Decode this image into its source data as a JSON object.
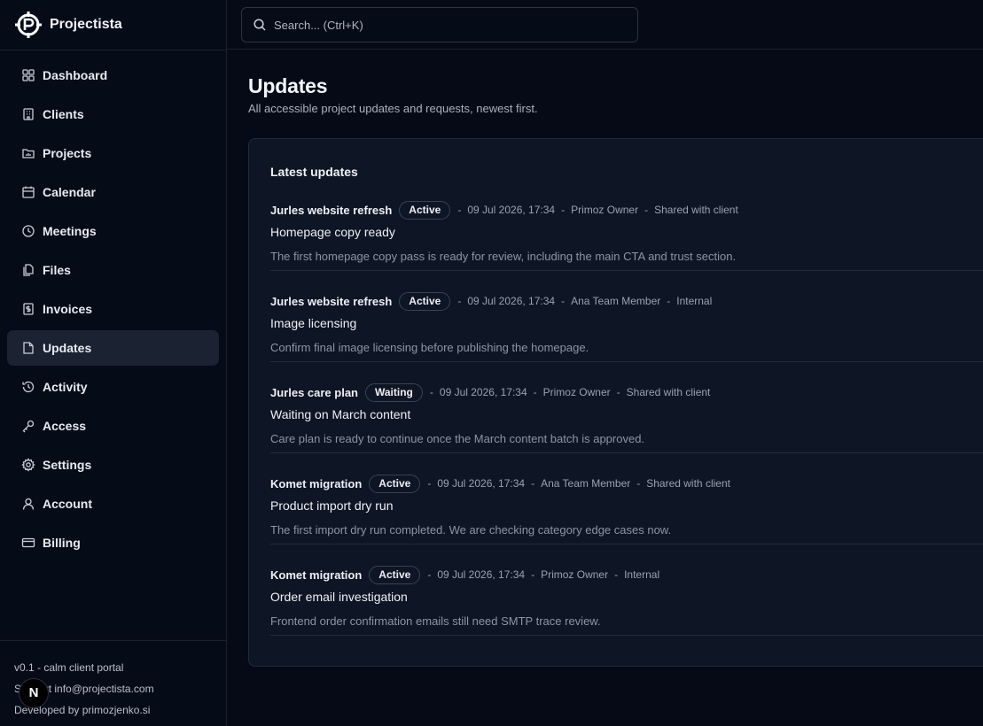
{
  "app": {
    "name": "Projectista"
  },
  "search": {
    "placeholder": "Search... (Ctrl+K)"
  },
  "sidebar": {
    "items": [
      {
        "label": "Dashboard",
        "icon": "grid-icon"
      },
      {
        "label": "Clients",
        "icon": "building-icon"
      },
      {
        "label": "Projects",
        "icon": "folder-icon"
      },
      {
        "label": "Calendar",
        "icon": "calendar-icon"
      },
      {
        "label": "Meetings",
        "icon": "clock-icon"
      },
      {
        "label": "Files",
        "icon": "files-icon"
      },
      {
        "label": "Invoices",
        "icon": "invoice-icon"
      },
      {
        "label": "Updates",
        "icon": "file-icon",
        "active": true
      },
      {
        "label": "Activity",
        "icon": "history-icon"
      },
      {
        "label": "Access",
        "icon": "key-icon"
      },
      {
        "label": "Settings",
        "icon": "gear-icon"
      },
      {
        "label": "Account",
        "icon": "user-icon"
      },
      {
        "label": "Billing",
        "icon": "credit-card-icon"
      }
    ],
    "footer": {
      "version": "v0.1 - calm client portal",
      "support": "Support info@projectista.com",
      "developed": "Developed by primozjenko.si",
      "badge": "N"
    }
  },
  "page": {
    "title": "Updates",
    "subtitle": "All accessible project updates and requests, newest first."
  },
  "card": {
    "title": "Latest updates",
    "updates": [
      {
        "project": "Jurles website refresh",
        "status": "Active",
        "date": "09 Jul 2026, 17:34",
        "author": "Primoz Owner",
        "visibility": "Shared with client",
        "title": "Homepage copy ready",
        "body": "The first homepage copy pass is ready for review, including the main CTA and trust section."
      },
      {
        "project": "Jurles website refresh",
        "status": "Active",
        "date": "09 Jul 2026, 17:34",
        "author": "Ana Team Member",
        "visibility": "Internal",
        "title": "Image licensing",
        "body": "Confirm final image licensing before publishing the homepage."
      },
      {
        "project": "Jurles care plan",
        "status": "Waiting",
        "date": "09 Jul 2026, 17:34",
        "author": "Primoz Owner",
        "visibility": "Shared with client",
        "title": "Waiting on March content",
        "body": "Care plan is ready to continue once the March content batch is approved."
      },
      {
        "project": "Komet migration",
        "status": "Active",
        "date": "09 Jul 2026, 17:34",
        "author": "Ana Team Member",
        "visibility": "Shared with client",
        "title": "Product import dry run",
        "body": "The first import dry run completed. We are checking category edge cases now."
      },
      {
        "project": "Komet migration",
        "status": "Active",
        "date": "09 Jul 2026, 17:34",
        "author": "Primoz Owner",
        "visibility": "Internal",
        "title": "Order email investigation",
        "body": "Frontend order confirmation emails still need SMTP trace review."
      }
    ]
  }
}
